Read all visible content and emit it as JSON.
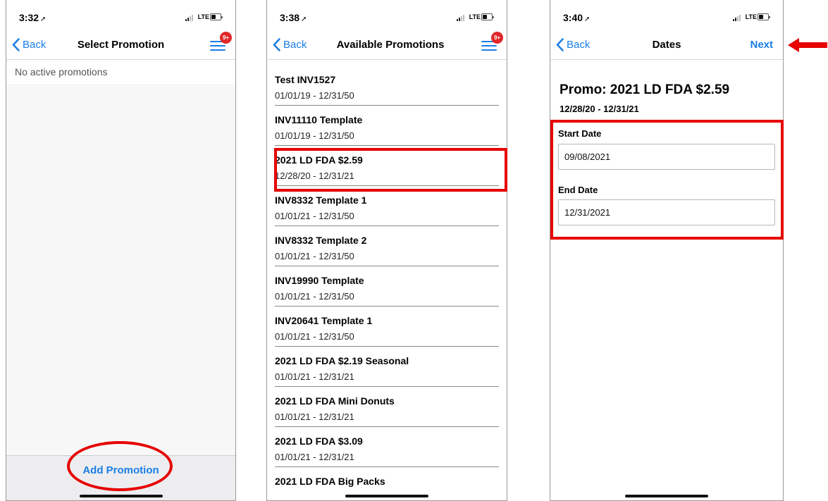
{
  "screens": [
    {
      "status": {
        "time": "3:32",
        "carrier": "LTE"
      },
      "nav": {
        "back": "Back",
        "title": "Select Promotion",
        "badge": "9+"
      },
      "empty_message": "No active promotions",
      "bottom": {
        "add_promotion": "Add Promotion"
      }
    },
    {
      "status": {
        "time": "3:38",
        "carrier": "LTE"
      },
      "nav": {
        "back": "Back",
        "title": "Available Promotions",
        "badge": "9+"
      },
      "promotions": [
        {
          "name": "Test INV1527",
          "dates": "01/01/19 - 12/31/50"
        },
        {
          "name": "INV11110 Template",
          "dates": "01/01/19 - 12/31/50"
        },
        {
          "name": "2021 LD FDA $2.59",
          "dates": "12/28/20 - 12/31/21"
        },
        {
          "name": "INV8332 Template 1",
          "dates": "01/01/21 - 12/31/50"
        },
        {
          "name": "INV8332 Template 2",
          "dates": "01/01/21 - 12/31/50"
        },
        {
          "name": "INV19990 Template",
          "dates": "01/01/21 - 12/31/50"
        },
        {
          "name": "INV20641 Template 1",
          "dates": "01/01/21 - 12/31/50"
        },
        {
          "name": "2021 LD FDA $2.19 Seasonal",
          "dates": "01/01/21 - 12/31/21"
        },
        {
          "name": "2021 LD FDA Mini Donuts",
          "dates": "01/01/21 - 12/31/21"
        },
        {
          "name": "2021 LD FDA $3.09",
          "dates": "01/01/21 - 12/31/21"
        },
        {
          "name": "2021 LD FDA Big Packs",
          "dates": ""
        }
      ]
    },
    {
      "status": {
        "time": "3:40",
        "carrier": "LTE"
      },
      "nav": {
        "back": "Back",
        "title": "Dates",
        "next": "Next"
      },
      "promo_title": "Promo: 2021 LD FDA $2.59",
      "promo_range": "12/28/20 - 12/31/21",
      "start_date_label": "Start Date",
      "start_date_value": "09/08/2021",
      "end_date_label": "End Date",
      "end_date_value": "12/31/2021"
    }
  ],
  "colors": {
    "accent": "#1a7ee6",
    "annotation": "#e60000",
    "badge": "#e0282a"
  },
  "icons": [
    "chevron-left-icon",
    "hamburger-menu-icon",
    "location-arrow-icon",
    "signal-icon",
    "battery-icon",
    "red-arrow-left-icon"
  ]
}
